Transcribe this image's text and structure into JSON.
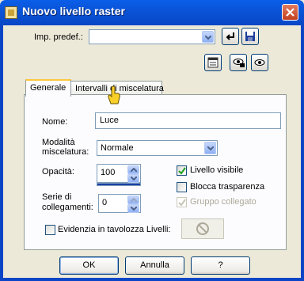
{
  "window": {
    "title": "Nuovo livello raster",
    "close_icon": "close-icon"
  },
  "preset": {
    "label": "Imp. predef.:",
    "value": ""
  },
  "tabs": [
    {
      "label": "Generale",
      "active": true
    },
    {
      "label": "Intervalli di miscelatura",
      "active": false
    }
  ],
  "general": {
    "name_label": "Nome:",
    "name_value": "Luce",
    "blend_label": "Modalità miscelatura:",
    "blend_label_line1": "Modalità",
    "blend_label_line2": "miscelatura:",
    "blend_value": "Normale",
    "opacity_label": "Opacità:",
    "opacity_value": "100",
    "link_label_line1": "Serie di",
    "link_label_line2": "collegamenti:",
    "link_value": "0",
    "visible_label": "Livello visibile",
    "visible_checked": true,
    "lock_label": "Blocca trasparenza",
    "lock_checked": false,
    "group_label": "Gruppo collegato",
    "group_checked": true,
    "group_disabled": true,
    "highlight_label": "Evidenzia in tavolozza Livelli:",
    "highlight_checked": false,
    "opacity_fraction": 1.0
  },
  "buttons": {
    "ok": "OK",
    "cancel": "Annulla",
    "help": "?"
  },
  "colors": {
    "titlebar": "#0a54d8",
    "dialog_bg": "#ece9d8",
    "tab_highlight": "#ffc83c",
    "checkmark": "#21a121"
  }
}
